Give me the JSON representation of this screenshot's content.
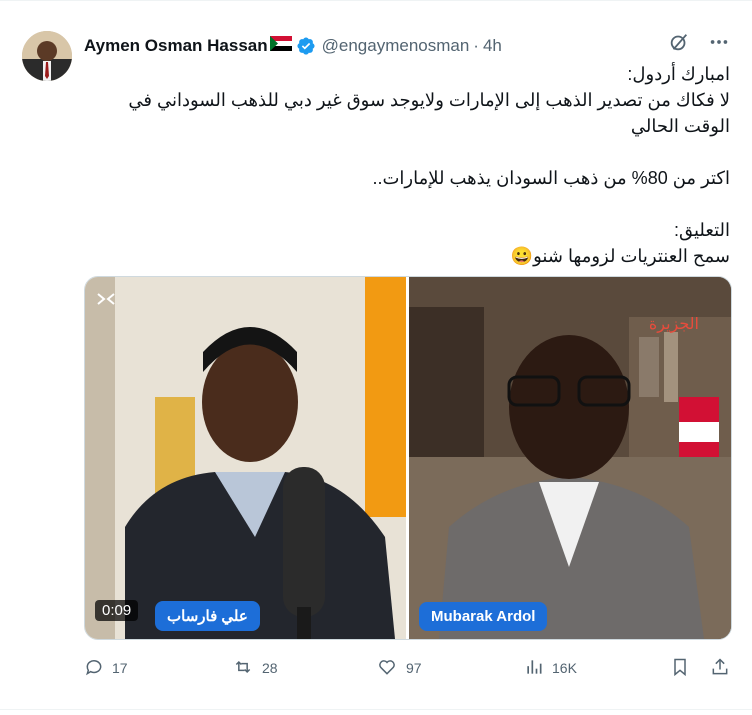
{
  "author": {
    "name": "Aymen Osman Hassan",
    "flag_emoji": "🇸🇩",
    "handle": "@engaymenosman",
    "separator": "·",
    "time": "4h"
  },
  "tweet": {
    "text": "امبارك أردول:\nلا فكاك من تصدير الذهب إلى الإمارات ولايوجد سوق غير دبي للذهب السوداني في الوقت الحالي\n\nاكتر من 80% من ذهب السودان يذهب للإمارات..\n\nالتعليق:\nسمح العنتريات لزومها شنو😀"
  },
  "media": {
    "left_speaker": "علي فارساب",
    "right_speaker": "Mubarak Ardol",
    "duration": "0:09",
    "watermark": "الجزيرة"
  },
  "actions": {
    "replies": "17",
    "reposts": "28",
    "likes": "97",
    "views": "16K"
  },
  "colors": {
    "accent": "#1d9bf0",
    "muted": "#536471",
    "nameplate": "#1d6ed8"
  },
  "icons": [
    "grok-icon",
    "more-icon",
    "verified-icon",
    "reply-icon",
    "repost-icon",
    "like-icon",
    "views-icon",
    "bookmark-icon",
    "share-icon",
    "captions-icon"
  ]
}
